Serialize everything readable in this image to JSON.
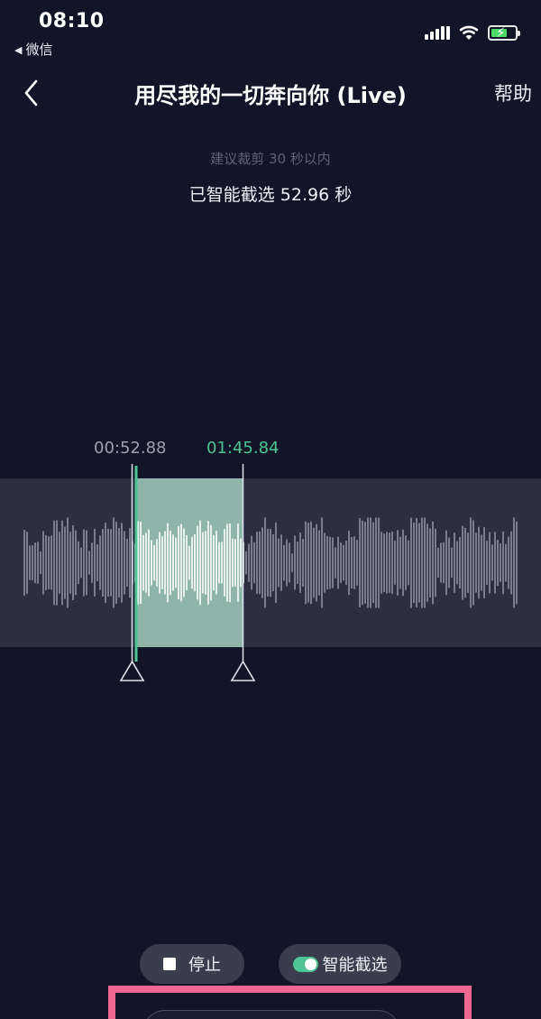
{
  "status_bar": {
    "time": "08:10",
    "back_app": "微信",
    "battery_color": "#4cd964"
  },
  "nav": {
    "title": "用尽我的一切奔向你 (Live)",
    "help": "帮助"
  },
  "trim": {
    "hint": "建议裁剪 30 秒以内",
    "selected_text": "已智能截选 52.96 秒",
    "start_time": "00:52.88",
    "end_time": "01:45.84",
    "selection_color": "#8fb4aa",
    "accent_color": "#4ec492"
  },
  "controls": {
    "stop_label": "停止",
    "smart_label": "智能截选",
    "smart_enabled": true
  },
  "highlight_color": "#f0678f"
}
